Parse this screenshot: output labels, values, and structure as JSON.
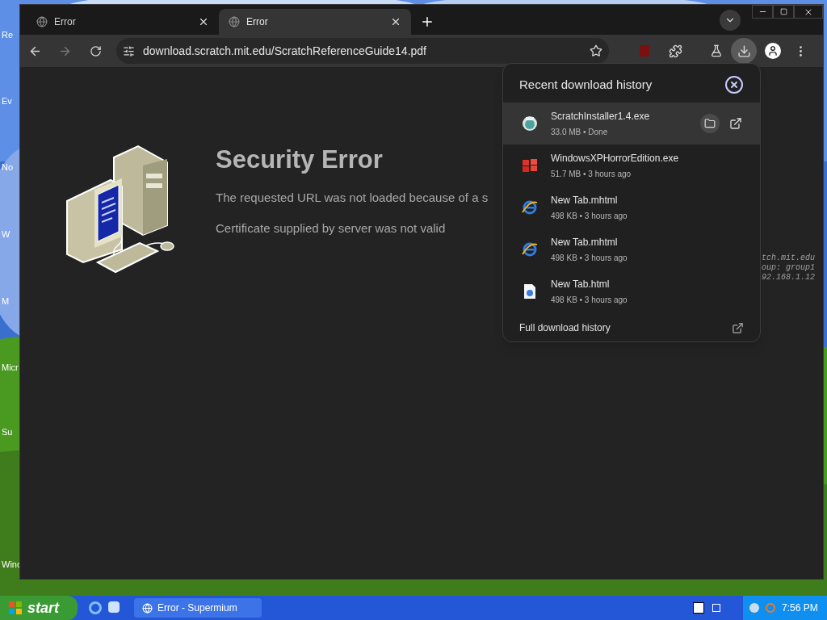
{
  "desktop_icons": [
    {
      "label": "Re"
    },
    {
      "label": "Ev"
    },
    {
      "label": "No"
    },
    {
      "label": "W"
    },
    {
      "label": "M"
    },
    {
      "label": "Micr"
    },
    {
      "label": "Su"
    },
    {
      "label": "Winc"
    }
  ],
  "tabs": [
    {
      "title": "Error",
      "selected": false
    },
    {
      "title": "Error",
      "selected": true
    }
  ],
  "address_bar": {
    "url": "download.scratch.mit.edu/ScratchReferenceGuide14.pdf"
  },
  "page": {
    "title": "Security Error",
    "lines": [
      "The requested URL was not loaded because of a s",
      "Certificate supplied by server was not valid"
    ],
    "background_text": [
      "tch.mit.edu",
      "oup: group1",
      "92.168.1.12"
    ]
  },
  "downloads_panel": {
    "title": "Recent download history",
    "footer": "Full download history",
    "items": [
      {
        "name": "ScratchInstaller1.4.exe",
        "detail": "33.0 MB • Done",
        "kind": "installer",
        "selected": true
      },
      {
        "name": "WindowsXPHorrorEdition.exe",
        "detail": "51.7 MB • 3 hours ago",
        "kind": "windows",
        "selected": false
      },
      {
        "name": "New Tab.mhtml",
        "detail": "498 KB • 3 hours ago",
        "kind": "ie",
        "selected": false
      },
      {
        "name": "New Tab.mhtml",
        "detail": "498 KB • 3 hours ago",
        "kind": "ie",
        "selected": false
      },
      {
        "name": "New Tab.html",
        "detail": "498 KB • 3 hours ago",
        "kind": "html",
        "selected": false
      }
    ]
  },
  "taskbar": {
    "start": "start",
    "tasks": [
      {
        "title": "Error - Supermium",
        "selected": false
      }
    ],
    "clock": "7:56 PM"
  }
}
